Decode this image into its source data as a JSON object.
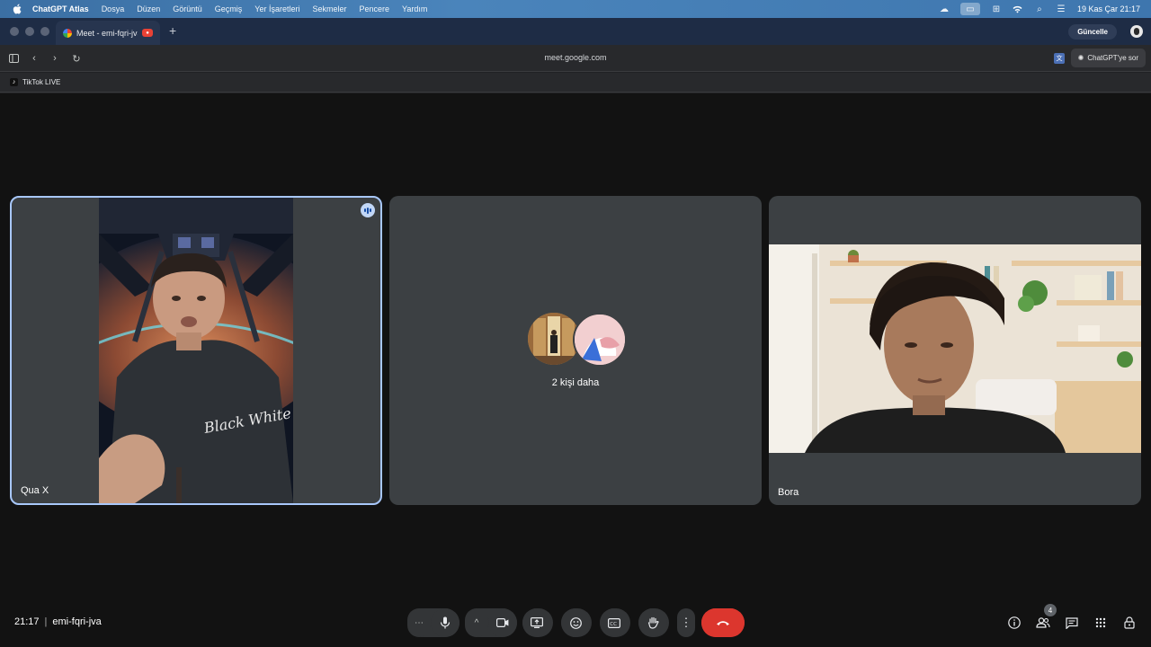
{
  "menubar": {
    "app_name": "ChatGPT Atlas",
    "items": [
      "Dosya",
      "Düzen",
      "Görüntü",
      "Geçmiş",
      "Yer İşaretleri",
      "Sekmeler",
      "Pencere",
      "Yardım"
    ],
    "datetime": "19 Kas Çar  21:17"
  },
  "browser": {
    "tab_title": "Meet - emi-fqri-jva",
    "update_label": "Güncelle",
    "url": "meet.google.com",
    "ask_label": "ChatGPT'ye sor",
    "bookmark_label": "TikTok LIVE"
  },
  "meet": {
    "participants": [
      {
        "name": "Qua X",
        "speaking": true
      },
      {
        "name": "2 kişi daha"
      },
      {
        "name": "Bora"
      }
    ],
    "more_people_label": "2 kişi daha",
    "shirt_text": "Black White",
    "time": "21:17",
    "meeting_code": "emi-fqri-jva",
    "people_count": "4",
    "colors": {
      "end_call": "#dc362e",
      "active_border": "#a8c7fa"
    }
  },
  "icons": {
    "more_options": "⋯",
    "chevron": "^",
    "kebab": "⋮"
  }
}
